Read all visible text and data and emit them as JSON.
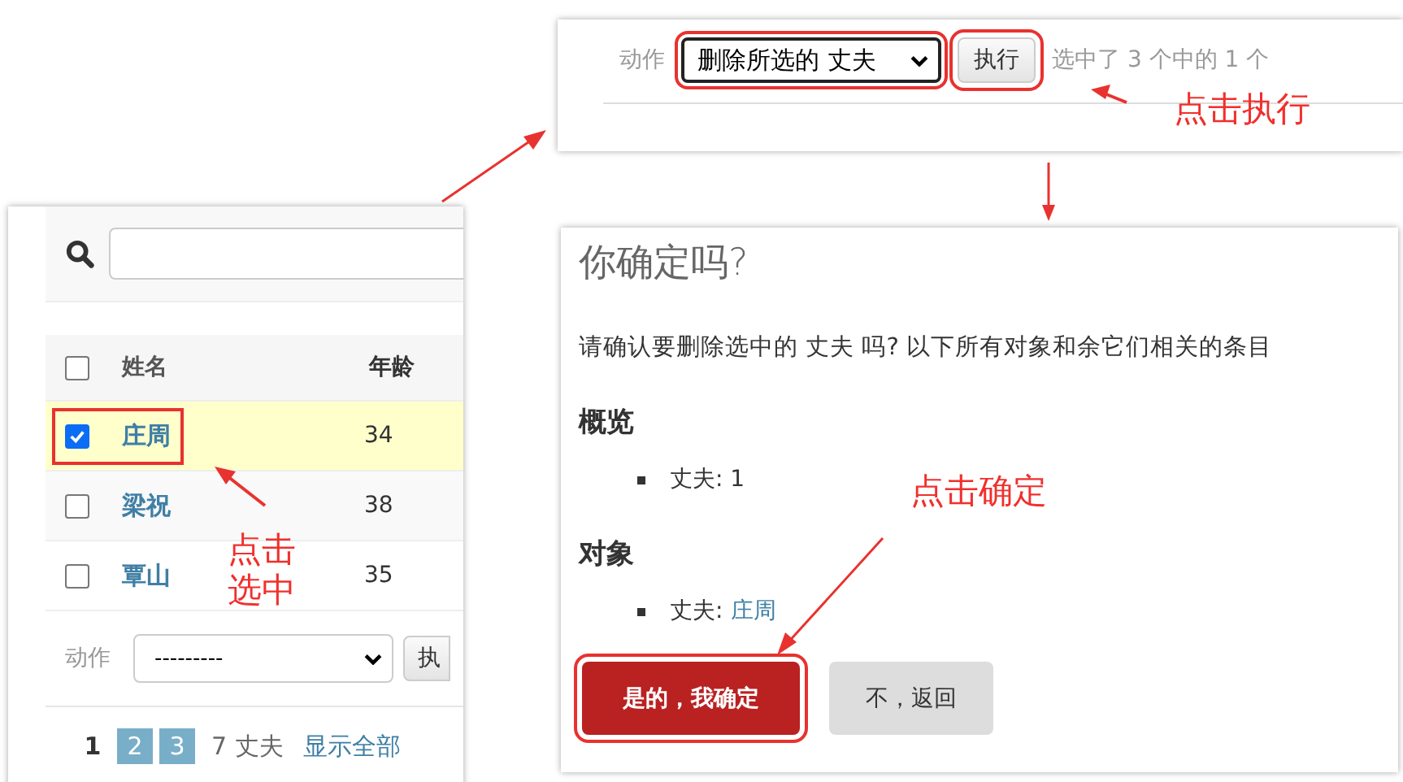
{
  "top_panel": {
    "action_label": "动作",
    "action_select": {
      "value": "删除所选的 丈夫"
    },
    "run_button": "执行",
    "selection_count": "选中了 3 个中的 1 个"
  },
  "list_panel": {
    "columns": [
      "姓名",
      "年龄"
    ],
    "header_checkbox": {
      "checked": false
    },
    "rows": [
      {
        "name": "庄周",
        "age": "34",
        "selected": true
      },
      {
        "name": "梁祝",
        "age": "38",
        "selected": false
      },
      {
        "name": "覃山",
        "age": "35",
        "selected": false
      }
    ],
    "action_label": "动作",
    "action_select": {
      "value": "---------"
    },
    "run_button": "执",
    "pagination": {
      "pages": [
        {
          "label": "1",
          "selected": true
        },
        {
          "label": "2",
          "selected": false
        },
        {
          "label": "3",
          "selected": false
        }
      ],
      "count": "7 丈夫",
      "show_all": "显示全部"
    }
  },
  "confirm_panel": {
    "title": "你确定吗?",
    "message": "请确认要删除选中的 丈夫 吗? 以下所有对象和余它们相关的条目",
    "sections": [
      {
        "heading": "概览",
        "items": [
          {
            "label": "丈夫:",
            "value": "1",
            "kind": "text"
          }
        ]
      },
      {
        "heading": "对象",
        "items": [
          {
            "label": "丈夫:",
            "value": "庄周",
            "kind": "link"
          }
        ]
      }
    ],
    "confirm_button": "是的，我确定",
    "cancel_button": "不，返回"
  },
  "annotations": [
    {
      "text": "点击执行"
    },
    {
      "text": "点击选中"
    },
    {
      "text": "点击确定"
    }
  ]
}
